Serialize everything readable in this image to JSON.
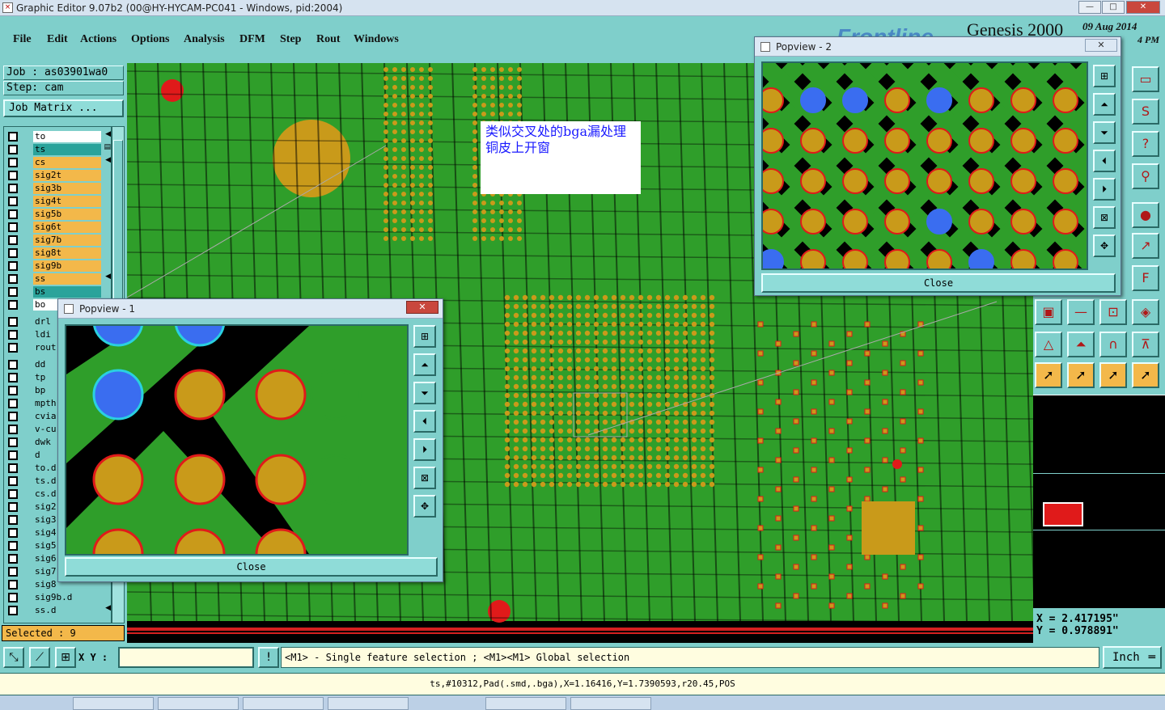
{
  "window": {
    "title": "Graphic Editor 9.07b2 (00@HY-HYCAM-PC041 - Windows, pid:2004)",
    "min": "—",
    "max": "□",
    "close": "✕"
  },
  "menu": [
    "File",
    "Edit",
    "Actions",
    "Options",
    "Analysis",
    "DFM",
    "Step",
    "Rout",
    "Windows"
  ],
  "brand": {
    "product": "Genesis 2000",
    "vendor": "Frontline",
    "date": "09 Aug 2014",
    "time": "4 PM"
  },
  "job": {
    "job_line": "Job : as03901wa0",
    "step_line": "Step: cam",
    "matrix_button": "Job Matrix ..."
  },
  "layers": [
    {
      "name": "to",
      "color": "#ffffff",
      "arrow": "◀"
    },
    {
      "name": "ts",
      "color": "#2aa39b",
      "arrow": "▤"
    },
    {
      "name": "cs",
      "color": "#f3b84a",
      "arrow": "◀"
    },
    {
      "name": "sig2t",
      "color": "#f3b84a",
      "arrow": ""
    },
    {
      "name": "sig3b",
      "color": "#f3b84a",
      "arrow": ""
    },
    {
      "name": "sig4t",
      "color": "#f3b84a",
      "arrow": ""
    },
    {
      "name": "sig5b",
      "color": "#f3b84a",
      "arrow": ""
    },
    {
      "name": "sig6t",
      "color": "#f3b84a",
      "arrow": ""
    },
    {
      "name": "sig7b",
      "color": "#f3b84a",
      "arrow": ""
    },
    {
      "name": "sig8t",
      "color": "#f3b84a",
      "arrow": ""
    },
    {
      "name": "sig9b",
      "color": "#f3b84a",
      "arrow": ""
    },
    {
      "name": "ss",
      "color": "#f3b84a",
      "arrow": "◀"
    },
    {
      "name": "bs",
      "color": "#2aa39b",
      "arrow": ""
    },
    {
      "name": "bo",
      "color": "#ffffff",
      "arrow": ""
    },
    {
      "name": "drl",
      "color": "#7fcfcb",
      "arrow": ""
    },
    {
      "name": "ldi",
      "color": "#7fcfcb",
      "arrow": ""
    },
    {
      "name": "rout",
      "color": "#7fcfcb",
      "arrow": ""
    },
    {
      "name": "dd",
      "color": "#7fcfcb",
      "arrow": ""
    },
    {
      "name": "tp",
      "color": "#7fcfcb",
      "arrow": ""
    },
    {
      "name": "bp",
      "color": "#7fcfcb",
      "arrow": ""
    },
    {
      "name": "mpth",
      "color": "#7fcfcb",
      "arrow": ""
    },
    {
      "name": "cvia",
      "color": "#7fcfcb",
      "arrow": ""
    },
    {
      "name": "v-cu",
      "color": "#7fcfcb",
      "arrow": ""
    },
    {
      "name": "dwk",
      "color": "#7fcfcb",
      "arrow": ""
    },
    {
      "name": "d",
      "color": "#7fcfcb",
      "arrow": ""
    },
    {
      "name": "to.d",
      "color": "#7fcfcb",
      "arrow": ""
    },
    {
      "name": "ts.d",
      "color": "#7fcfcb",
      "arrow": ""
    },
    {
      "name": "cs.d",
      "color": "#7fcfcb",
      "arrow": ""
    },
    {
      "name": "sig2",
      "color": "#7fcfcb",
      "arrow": ""
    },
    {
      "name": "sig3",
      "color": "#7fcfcb",
      "arrow": ""
    },
    {
      "name": "sig4",
      "color": "#7fcfcb",
      "arrow": ""
    },
    {
      "name": "sig5",
      "color": "#7fcfcb",
      "arrow": ""
    },
    {
      "name": "sig6",
      "color": "#7fcfcb",
      "arrow": ""
    },
    {
      "name": "sig7",
      "color": "#7fcfcb",
      "arrow": ""
    },
    {
      "name": "sig8",
      "color": "#7fcfcb",
      "arrow": ""
    },
    {
      "name": "sig9b.d",
      "color": "#7fcfcb",
      "arrow": ""
    },
    {
      "name": "ss.d",
      "color": "#7fcfcb",
      "arrow": "◀"
    }
  ],
  "selected": "Selected : 9",
  "annotation": "类似交叉处的bga漏处理铜皮上开窗",
  "popview1": {
    "title": "Popview - 1",
    "close_button": "Close"
  },
  "popview2": {
    "title": "Popview - 2",
    "close_button": "Close"
  },
  "coords": {
    "x": "X = 2.417195\"",
    "y": "Y = 0.978891\""
  },
  "bottom": {
    "xy_label": "X Y :",
    "xy_value": "",
    "message": "<M1> - Single feature selection ; <M1><M1> Global selection",
    "unit": "Inch",
    "unit_arrow": "═"
  },
  "status": "ts,#10312,Pad(.smd,.bga),X=1.16416,Y=1.7390593,r20.45,POS",
  "colors": {
    "panel": "#7fcfcb",
    "copper": "#c99a1a",
    "mask": "#2f9e2a",
    "pad_red": "#e01a1a",
    "pad_blue": "#3a6df0"
  }
}
